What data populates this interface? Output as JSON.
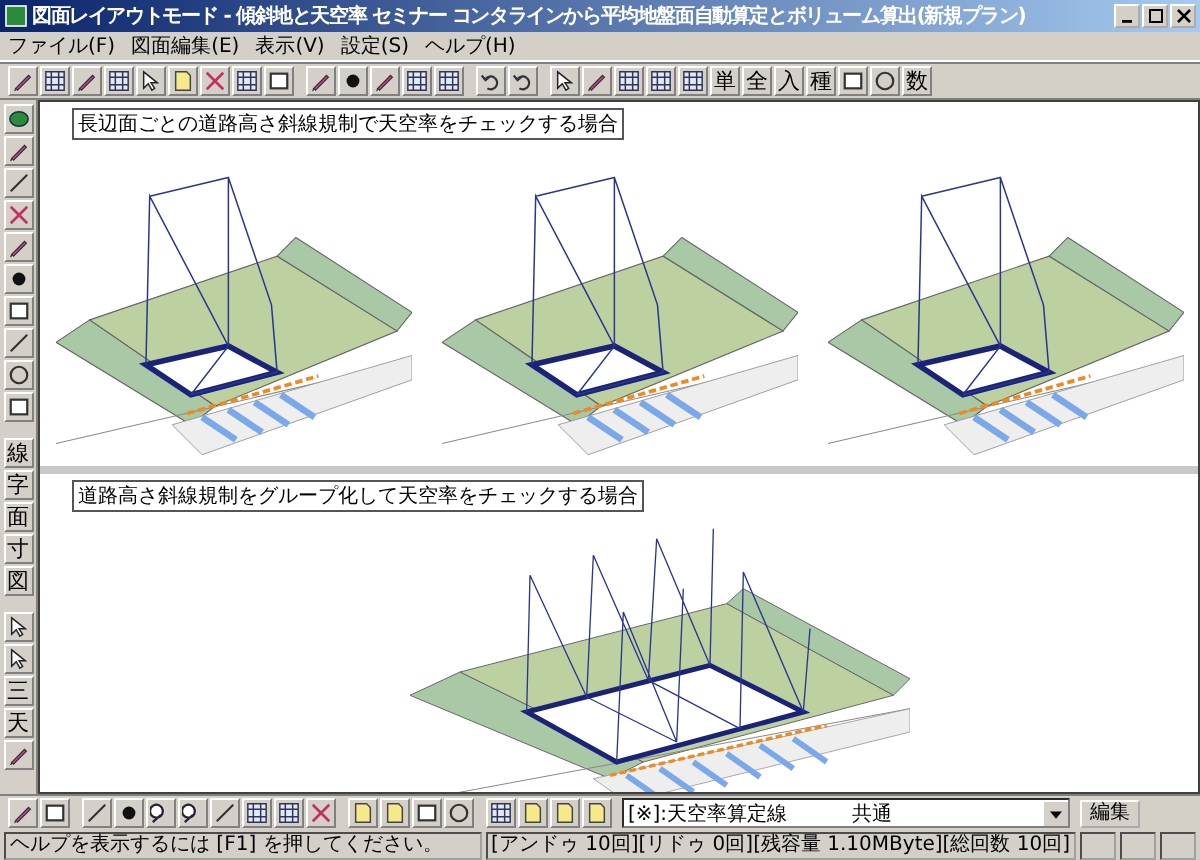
{
  "window": {
    "title": "図面レイアウトモード - 傾斜地と天空率 セミナー コンタラインから平均地盤面自動算定とボリューム算出(新規プラン)"
  },
  "menu": [
    "ファイル(F)",
    "図面編集(E)",
    "表示(V)",
    "設定(S)",
    "ヘルプ(H)"
  ],
  "toolbar": [
    {
      "kind": "pen"
    },
    {
      "kind": "grid"
    },
    {
      "kind": "pen"
    },
    {
      "kind": "grid"
    },
    {
      "kind": "cursor"
    },
    {
      "kind": "page"
    },
    {
      "kind": "cross"
    },
    {
      "kind": "grid"
    },
    {
      "kind": "rect"
    },
    {
      "kind": "sep"
    },
    {
      "kind": "pen"
    },
    {
      "kind": "dot"
    },
    {
      "kind": "pen"
    },
    {
      "kind": "grid"
    },
    {
      "kind": "grid"
    },
    {
      "kind": "sep"
    },
    {
      "kind": "undo"
    },
    {
      "kind": "undo"
    },
    {
      "kind": "sep"
    },
    {
      "kind": "cursor"
    },
    {
      "kind": "pen"
    },
    {
      "kind": "grid"
    },
    {
      "kind": "grid"
    },
    {
      "kind": "grid"
    },
    {
      "kind": "text",
      "label": "単"
    },
    {
      "kind": "text",
      "label": "全"
    },
    {
      "kind": "text",
      "label": "入"
    },
    {
      "kind": "text",
      "label": "種"
    },
    {
      "kind": "rect"
    },
    {
      "kind": "circle"
    },
    {
      "kind": "text",
      "label": "数"
    }
  ],
  "sidebar": [
    {
      "kind": "leaf"
    },
    {
      "kind": "pen"
    },
    {
      "kind": "line"
    },
    {
      "kind": "cross"
    },
    {
      "kind": "pen"
    },
    {
      "kind": "dot"
    },
    {
      "kind": "rect"
    },
    {
      "kind": "line"
    },
    {
      "kind": "circle"
    },
    {
      "kind": "rect"
    },
    {
      "kind": "sep"
    },
    {
      "kind": "text",
      "label": "線"
    },
    {
      "kind": "text",
      "label": "字"
    },
    {
      "kind": "text",
      "label": "面"
    },
    {
      "kind": "text",
      "label": "寸"
    },
    {
      "kind": "text",
      "label": "図"
    },
    {
      "kind": "sep"
    },
    {
      "kind": "cursor"
    },
    {
      "kind": "cursor"
    },
    {
      "kind": "text",
      "label": "三"
    },
    {
      "kind": "text",
      "label": "天"
    },
    {
      "kind": "pen"
    }
  ],
  "panels": [
    {
      "kind": "three-views",
      "label": "長辺面ごとの道路高さ斜線規制で天空率をチェックする場合"
    },
    {
      "kind": "grouped-view",
      "label": "道路高さ斜線規制をグループ化して天空率をチェックする場合"
    }
  ],
  "bottom_toolbar": [
    {
      "kind": "pen"
    },
    {
      "kind": "rect"
    },
    {
      "kind": "sep"
    },
    {
      "kind": "line"
    },
    {
      "kind": "dot"
    },
    {
      "kind": "zoom"
    },
    {
      "kind": "zoom"
    },
    {
      "kind": "line"
    },
    {
      "kind": "grid"
    },
    {
      "kind": "grid"
    },
    {
      "kind": "cross"
    },
    {
      "kind": "sep"
    },
    {
      "kind": "page"
    },
    {
      "kind": "page"
    },
    {
      "kind": "rect"
    },
    {
      "kind": "circle"
    },
    {
      "kind": "sep"
    },
    {
      "kind": "grid"
    },
    {
      "kind": "page"
    },
    {
      "kind": "page"
    },
    {
      "kind": "page"
    }
  ],
  "layer_select": {
    "value": "[※]:天空率算定線",
    "group": "共通"
  },
  "edit_button": "編集",
  "status_bar": {
    "help": "ヘルプを表示するには [F1] を押してください。",
    "info": "[アンドゥ 10回][リドゥ 0回][残容量 1.10MByte][総回数 10回]"
  }
}
